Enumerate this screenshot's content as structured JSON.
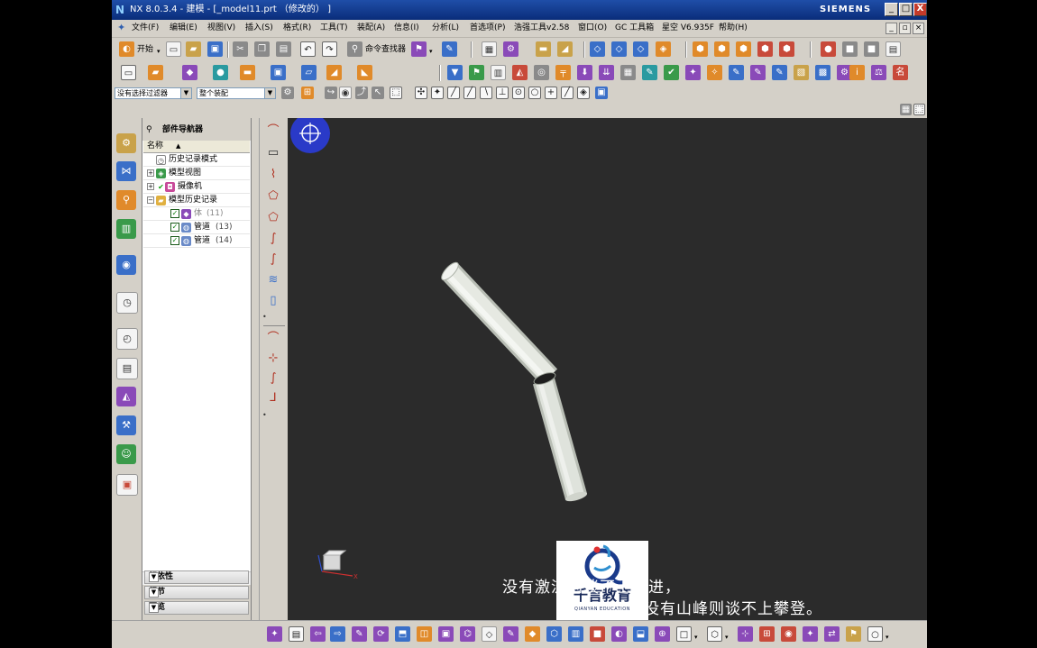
{
  "window": {
    "title": "NX 8.0.3.4 - 建模 - [_model11.prt （修改的） ]",
    "brand": "SIEMENS",
    "controls": [
      "_",
      "□",
      "X"
    ]
  },
  "menu": {
    "items": [
      "文件(F)",
      "编辑(E)",
      "视图(V)",
      "插入(S)",
      "格式(R)",
      "工具(T)",
      "装配(A)",
      "信息(I)",
      "分析(L)",
      "首选项(P)",
      "浩强工具v2.58",
      "窗口(O)",
      "GC 工具箱",
      "星空 V6.935F",
      "帮助(H)"
    ]
  },
  "toolbar": {
    "start_label": "开始",
    "command_finder_label": "命令查找器"
  },
  "selection_bar": {
    "filter_value": "没有选择过滤器",
    "scope_value": "整个装配"
  },
  "navigator": {
    "title": "部件导航器",
    "column_header": "名称",
    "items": [
      {
        "label": "历史记录模式",
        "count": ""
      },
      {
        "label": "模型视图",
        "count": ""
      },
      {
        "label": "摄像机",
        "count": ""
      },
      {
        "label": "模型历史记录",
        "count": ""
      },
      {
        "label": "体",
        "count": "(11)"
      },
      {
        "label": "管道",
        "count": "(13)"
      },
      {
        "label": "管道",
        "count": "(14)"
      }
    ],
    "panels": [
      "相依性",
      "细节",
      "预览"
    ]
  },
  "overlay": {
    "subtitle_line1": "没有激流则谈不上勇进，",
    "subtitle_line2": "没有山峰则谈不上攀登。",
    "logo_cn": "千言教育",
    "logo_en": "QIANYAN EDUCATION"
  },
  "triad_axis_label": "X",
  "colors": {
    "titlebar": "#0a2d7a",
    "viewport_bg": "#2b2b2b",
    "pipe": "#dfe3dc",
    "chrome": "#d4d0c8"
  },
  "icons": {
    "left_resource_bar": [
      "assembly-navigator-icon",
      "constraint-navigator-icon",
      "part-navigator-icon",
      "reuse-library-icon",
      "web-browser-icon",
      "history-icon",
      "system-materials-icon",
      "process-studio-icon",
      "roles-icon",
      "hd3d-tools-icon",
      "palette-icon"
    ]
  }
}
